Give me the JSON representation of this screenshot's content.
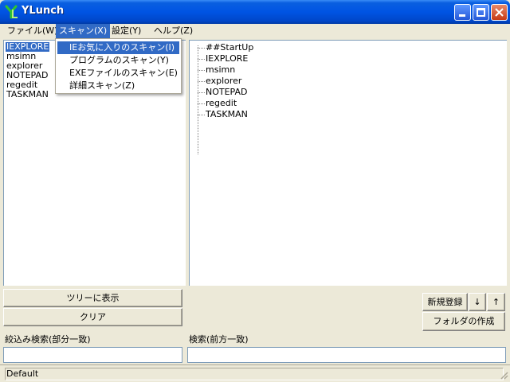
{
  "window": {
    "title": "YLunch"
  },
  "menubar": {
    "items": [
      "ファイル(W)",
      "スキャン(X)",
      "設定(Y)",
      "ヘルプ(Z)"
    ],
    "active_index": 1
  },
  "scan_menu": {
    "items": [
      "IEお気に入りのスキャン(I)",
      "プログラムのスキャン(Y)",
      "EXEファイルのスキャン(E)",
      "詳細スキャン(Z)"
    ],
    "selected_index": 0
  },
  "left_list": {
    "items": [
      "IEXPLORE",
      "msimn",
      "explorer",
      "NOTEPAD",
      "regedit",
      "TASKMAN"
    ],
    "selected_index": 0
  },
  "tree": {
    "items": [
      "##StartUp",
      "IEXPLORE",
      "msimn",
      "explorer",
      "NOTEPAD",
      "regedit",
      "TASKMAN"
    ]
  },
  "buttons": {
    "show_in_tree": "ツリーに表示",
    "clear": "クリア",
    "new_register": "新規登録",
    "down": "↓",
    "up": "↑",
    "create_folder": "フォルダの作成"
  },
  "search": {
    "filter_label": "絞込み検索(部分一致)",
    "filter_value": "",
    "prefix_label": "検索(前方一致)",
    "prefix_value": ""
  },
  "status": {
    "text": "Default"
  },
  "colors": {
    "titlebar": "#0054e3",
    "selection": "#316ac5",
    "face": "#ece9d8",
    "app_icon": "#2fc52f"
  },
  "icons": {
    "app": "ylunch-app-icon",
    "minimize": "minimize-icon",
    "maximize": "maximize-icon",
    "close": "close-icon"
  }
}
